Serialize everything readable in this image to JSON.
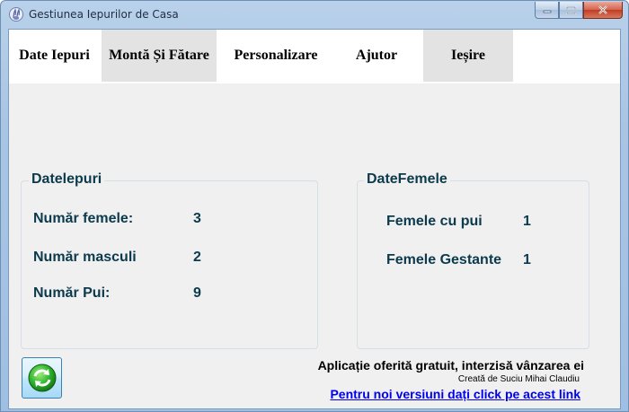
{
  "window": {
    "title": "Gestiunea Iepurilor de Casa",
    "icon": "rabbit-app-icon"
  },
  "menu": {
    "items": [
      {
        "label": "Date Iepuri",
        "shaded": false
      },
      {
        "label": "Montă Și Fătare",
        "shaded": true
      },
      {
        "label": "Personalizare",
        "shaded": false
      },
      {
        "label": "Ajutor",
        "shaded": false
      },
      {
        "label": "Ieșire",
        "shaded": true
      }
    ]
  },
  "date_iepuri": {
    "title": "Datelepuri",
    "rows": [
      {
        "label": "Număr femele:",
        "value": "3"
      },
      {
        "label": "Număr masculi",
        "value": "2"
      },
      {
        "label": "Număr Pui:",
        "value": "9"
      }
    ]
  },
  "date_femele": {
    "title": "DateFemele",
    "rows": [
      {
        "label": "Femele cu pui",
        "value": "1"
      },
      {
        "label": "Femele Gestante",
        "value": "1"
      }
    ]
  },
  "footer": {
    "refresh_icon": "refresh-icon",
    "promo": "Aplicație oferită gratuit, interzisă vânzarea ei",
    "credit": "Creată de Suciu Mihai Claudiu",
    "link": "Pentru noi versiuni dați click pe acest link"
  },
  "colors": {
    "label_text": "#0b3a4c",
    "link": "#0000ee",
    "client_bg": "#f0f0f0"
  }
}
